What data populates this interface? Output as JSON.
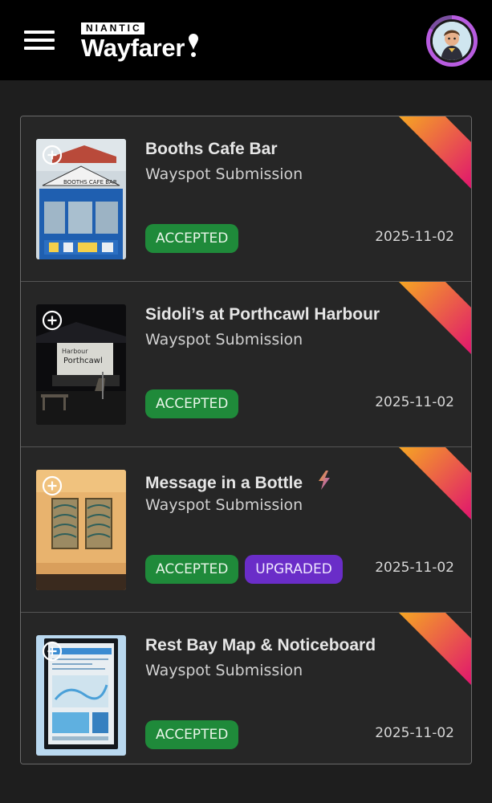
{
  "header": {
    "logo_brand": "NIANTIC",
    "logo_name": "Wayfarer",
    "menu_icon": "hamburger-menu-icon",
    "avatar_icon": "profile-avatar"
  },
  "colors": {
    "accepted": "#1f8a3a",
    "upgraded": "#6a2dc8",
    "ribbon_start": "#f5a623",
    "ribbon_end": "#e0156e"
  },
  "submissions": [
    {
      "title": "Booths Cafe Bar",
      "type": "Wayspot Submission",
      "status": "ACCEPTED",
      "date": "2025-11-02"
    },
    {
      "title": "Sidoli’s at Porthcawl Harbour",
      "type": "Wayspot Submission",
      "status": "ACCEPTED",
      "date": "2025-11-02"
    },
    {
      "title": "Message in a Bottle",
      "type": "Wayspot Submission",
      "status": "ACCEPTED",
      "status2": "UPGRADED",
      "date": "2025-11-02"
    },
    {
      "title": "Rest Bay Map & Noticeboard",
      "type": "Wayspot Submission",
      "status": "ACCEPTED",
      "date": "2025-11-02"
    }
  ]
}
